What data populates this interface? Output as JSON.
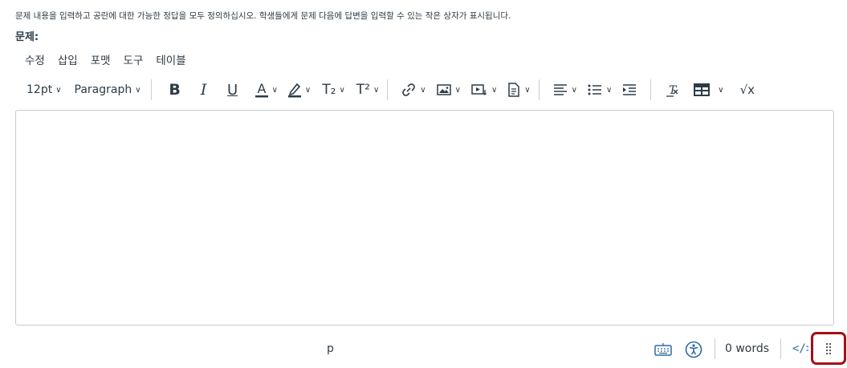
{
  "instructions": "문제 내용을 입력하고 공란에 대한 가능한 정답을 모두 정의하십시오. 학생들에게 문제 다음에 답변을 입력할 수 있는 작은 상자가 표시됩니다.",
  "question_label": "문제:",
  "menu": [
    "수정",
    "삽입",
    "포맷",
    "도구",
    "테이블"
  ],
  "toolbar": {
    "font_size": "12pt",
    "block_format": "Paragraph",
    "subscript": "T₂",
    "superscript": "T²",
    "math": "√x"
  },
  "status": {
    "path": "p",
    "word_count": "0 words",
    "html_toggle": "</>"
  },
  "colors": {
    "text": "#2d3b45",
    "link_blue": "#2d6ba1",
    "border": "#c7cdd1",
    "highlight_red": "#a50e16"
  }
}
